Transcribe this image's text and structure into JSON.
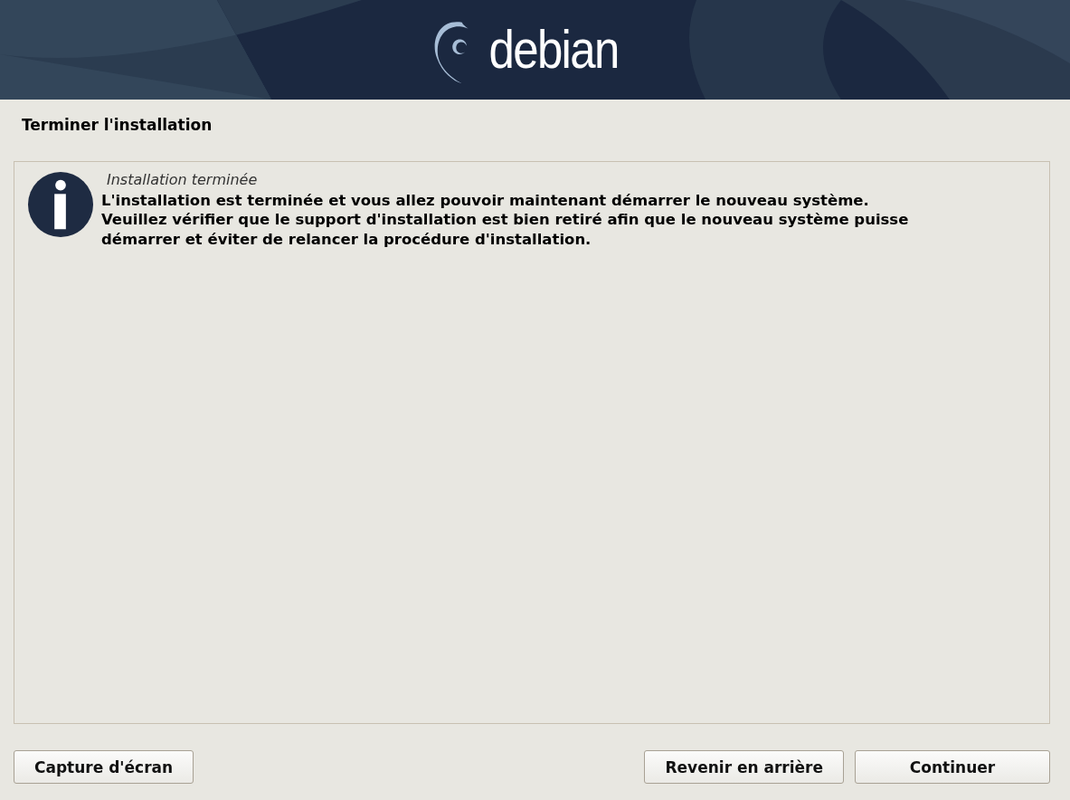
{
  "banner": {
    "logo_text": "debian"
  },
  "page_title": "Terminer l'installation",
  "message": {
    "kind": "info",
    "title": "Installation terminée",
    "text": "L'installation est terminée et vous allez pouvoir maintenant démarrer le nouveau système.\nVeuillez vérifier que le support d'installation est bien retiré afin que le nouveau système puisse\ndémarrer et éviter de relancer la procédure d'installation."
  },
  "buttons": {
    "left": [
      "Capture d'écran"
    ],
    "right": [
      "Revenir en arrière",
      "Continuer"
    ]
  }
}
